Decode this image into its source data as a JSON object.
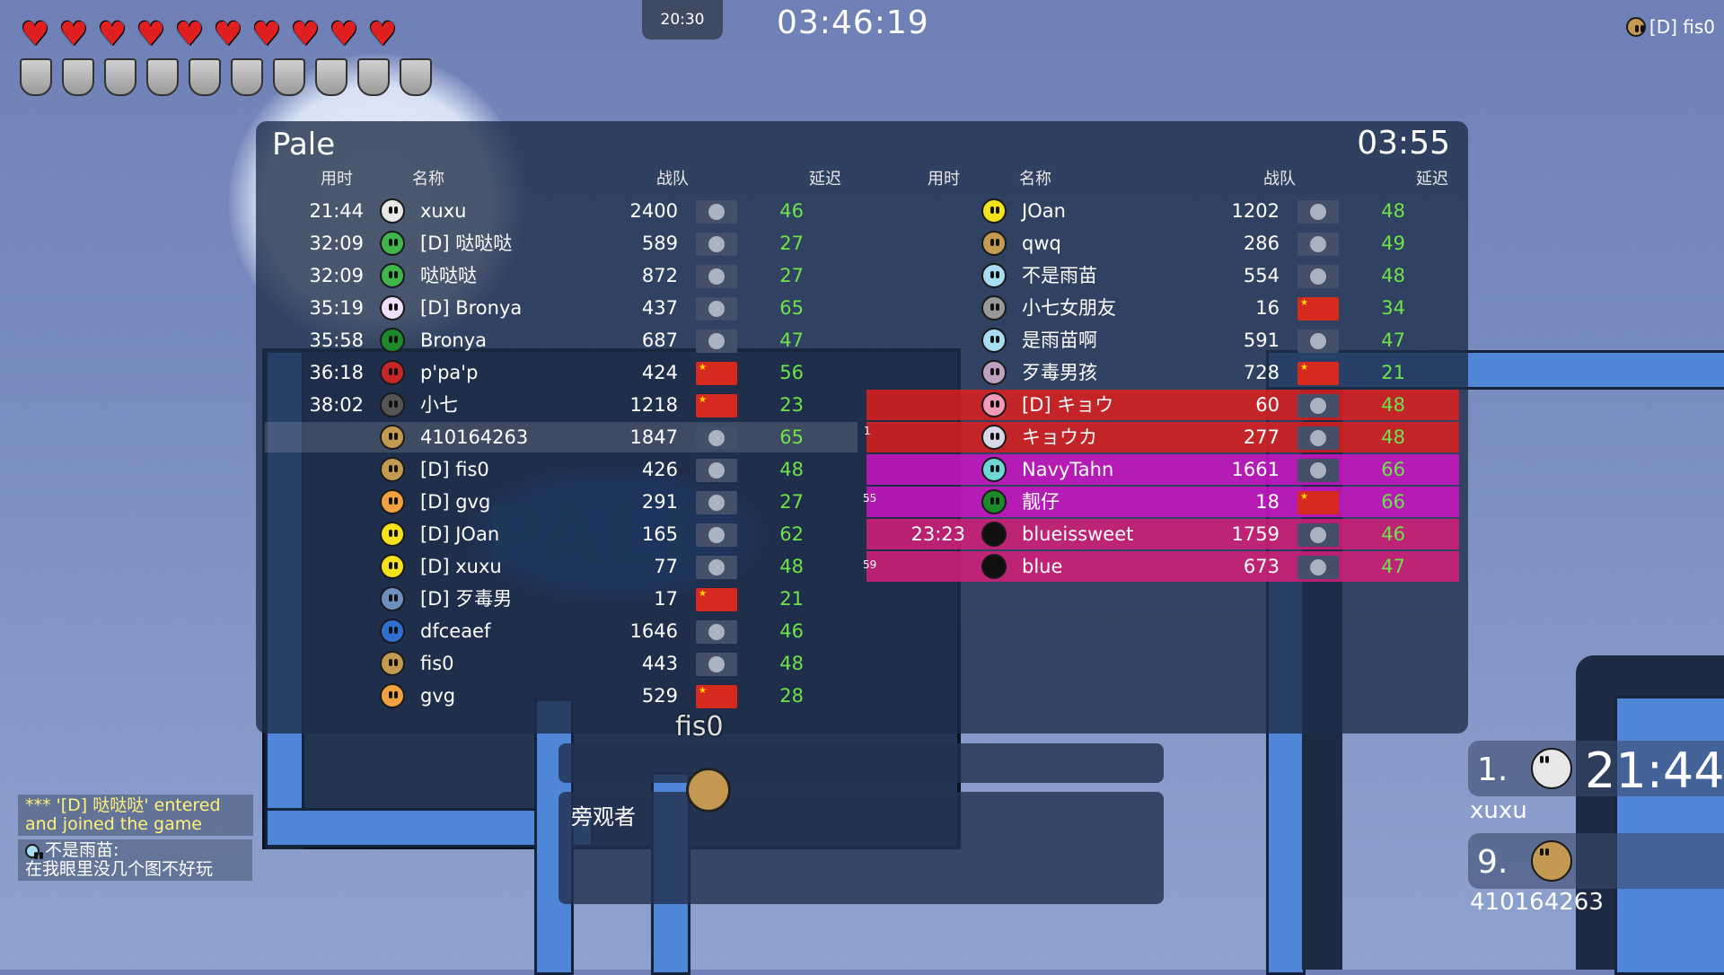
{
  "hud": {
    "hearts": 10,
    "shields": 10,
    "clock": "20:30",
    "race_time": "03:46:19",
    "top_user": "[D] fis0"
  },
  "board": {
    "title": "Pale",
    "time": "03:55",
    "headers": {
      "time": "用时",
      "name": "名称",
      "clan": "战队",
      "ping": "延迟"
    },
    "left": [
      {
        "time": "21:44",
        "name": "xuxu",
        "score": "2400",
        "ping": "46",
        "flag": "default",
        "skin": "#e8e8e8"
      },
      {
        "time": "32:09",
        "name": "[D] 哒哒哒",
        "score": "589",
        "ping": "27",
        "flag": "default",
        "skin": "#3fb54a"
      },
      {
        "time": "32:09",
        "name": "哒哒哒",
        "score": "872",
        "ping": "27",
        "flag": "default",
        "skin": "#3fb54a"
      },
      {
        "time": "35:19",
        "name": "[D] Bronya",
        "score": "437",
        "ping": "65",
        "flag": "default",
        "skin": "#f0e0ff"
      },
      {
        "time": "35:58",
        "name": "Bronya",
        "score": "687",
        "ping": "47",
        "flag": "default",
        "skin": "#1d8a2a"
      },
      {
        "time": "36:18",
        "name": "p'pa'p",
        "score": "424",
        "ping": "56",
        "flag": "cn",
        "skin": "#c62828"
      },
      {
        "time": "38:02",
        "name": "小七",
        "score": "1218",
        "ping": "23",
        "flag": "cn",
        "skin": "#555555"
      },
      {
        "time": "",
        "name": "410164263",
        "score": "1847",
        "ping": "65",
        "flag": "default",
        "skin": "#c49a52"
      },
      {
        "time": "",
        "name": "[D] fis0",
        "score": "426",
        "ping": "48",
        "flag": "default",
        "skin": "#c49a52"
      },
      {
        "time": "",
        "name": "[D] gvg",
        "score": "291",
        "ping": "27",
        "flag": "default",
        "skin": "#f0a040"
      },
      {
        "time": "",
        "name": "[D] JOan",
        "score": "165",
        "ping": "62",
        "flag": "default",
        "skin": "#f5e11c"
      },
      {
        "time": "",
        "name": "[D] xuxu",
        "score": "77",
        "ping": "48",
        "flag": "default",
        "skin": "#f5e11c"
      },
      {
        "time": "",
        "name": "[D] 歹毒男",
        "score": "17",
        "ping": "21",
        "flag": "cn",
        "skin": "#6d8fc0"
      },
      {
        "time": "",
        "name": "dfceaef",
        "score": "1646",
        "ping": "46",
        "flag": "default",
        "skin": "#2f6fd0"
      },
      {
        "time": "",
        "name": "fis0",
        "score": "443",
        "ping": "48",
        "flag": "default",
        "skin": "#c49a52"
      },
      {
        "time": "",
        "name": "gvg",
        "score": "529",
        "ping": "28",
        "flag": "cn",
        "skin": "#f0a040"
      }
    ],
    "right": [
      {
        "time": "",
        "name": "JOan",
        "score": "1202",
        "ping": "48",
        "flag": "default",
        "skin": "#f5e11c"
      },
      {
        "time": "",
        "name": "qwq",
        "score": "286",
        "ping": "49",
        "flag": "default",
        "skin": "#c49a52"
      },
      {
        "time": "",
        "name": "不是雨苗",
        "score": "554",
        "ping": "48",
        "flag": "default",
        "skin": "#a8dcf0"
      },
      {
        "time": "",
        "name": "小七女朋友",
        "score": "16",
        "ping": "34",
        "flag": "cn",
        "skin": "#999999"
      },
      {
        "time": "",
        "name": "是雨苗啊",
        "score": "591",
        "ping": "47",
        "flag": "default",
        "skin": "#a8dcf0"
      },
      {
        "time": "",
        "name": "歹毒男孩",
        "score": "728",
        "ping": "21",
        "flag": "cn",
        "skin": "#c0a0c0"
      },
      {
        "time": "",
        "name": "[D] キョウ",
        "score": "60",
        "ping": "48",
        "flag": "default",
        "skin": "#f29ab8"
      },
      {
        "time": "",
        "name": "キョウカ",
        "score": "277",
        "ping": "48",
        "flag": "default",
        "skin": "#d8d8e8"
      },
      {
        "time": "",
        "name": "NavyTahn",
        "score": "1661",
        "ping": "66",
        "flag": "default",
        "skin": "#6fd6d6"
      },
      {
        "time": "",
        "name": "靓仔",
        "score": "18",
        "ping": "66",
        "flag": "cn",
        "skin": "#1d8a2a"
      },
      {
        "time": "23:23",
        "name": "blueissweet",
        "score": "1759",
        "ping": "46",
        "flag": "default",
        "skin": "#101010"
      },
      {
        "time": "",
        "name": "blue",
        "score": "673",
        "ping": "47",
        "flag": "default",
        "skin": "#101010"
      }
    ],
    "team_tags": {
      "kyou": "1",
      "navy": "55",
      "blue": "59"
    }
  },
  "spectators": {
    "label": "旁观者",
    "player_name": "fis0"
  },
  "chat": {
    "system": "*** '[D] 哒哒哒' entered and joined the game",
    "author": "不是雨苗:",
    "message": "在我眼里没几个图不好玩"
  },
  "rank": {
    "first_pos": "1.",
    "first_time": "21:44",
    "first_name": "xuxu",
    "self_pos": "9.",
    "self_name": "410164263"
  },
  "colors": {
    "ping": "#6ee34a",
    "team_red": "#dc1e1e",
    "team_magenta": "#d214c8",
    "team_pink": "#d71e78"
  }
}
